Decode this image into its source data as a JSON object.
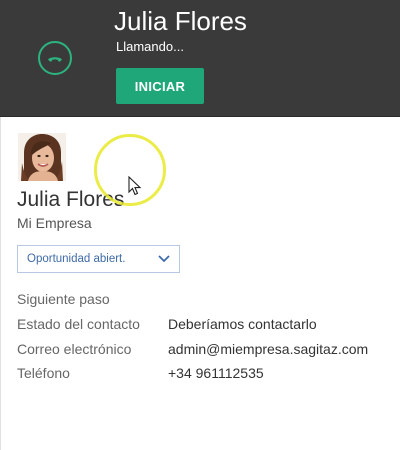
{
  "call": {
    "caller_name": "Julia Flores",
    "status": "Llamando...",
    "start_label": "INICIAR"
  },
  "contact": {
    "name": "Julia Flores",
    "company": "Mi Empresa",
    "stage": {
      "selected": "Oportunidad abiert."
    },
    "fields": [
      {
        "label": "Siguiente paso",
        "value": ""
      },
      {
        "label": "Estado del contacto",
        "value": "Deberíamos contactarlo"
      },
      {
        "label": "Correo electrónico",
        "value": "admin@miempresa.sagitaz.com"
      },
      {
        "label": "Teléfono",
        "value": "+34 961112535"
      }
    ]
  },
  "colors": {
    "header_bg": "#3a3a3a",
    "accent_green": "#1fa77a",
    "link_blue": "#3e6aa8",
    "highlight_yellow": "#e8e928"
  },
  "icons": {
    "call": "phone-handset-icon",
    "dropdown": "chevron-down-icon",
    "cursor": "mouse-pointer-icon"
  }
}
